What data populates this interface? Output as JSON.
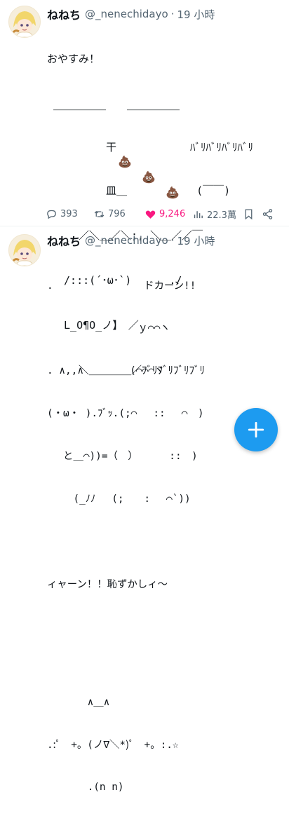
{
  "tweets": [
    {
      "display_name": "ねねち",
      "handle": "@_nenechidayo",
      "separator": "·",
      "time": "19 小時",
      "lines": [
        "おやすみ！",
        " ＿＿＿＿＿　　＿＿＿＿＿",
        "　　　　　 干　　　　　　　ﾊﾞﾘﾊﾞﾘﾊﾞﾘﾊﾞﾘ",
        "　　　　　 皿＿　　　　　　 (￣￣)",
        "　　　／＼＿／＼;, ＼＿／／￣",
        "　 /:::(´･ω･`)　　　 ./",
        "　 L_O¶O_ノ】　／",
        "　　　＼＿＿＿＿／ﾌﾞﾘﾌﾞﾘﾌﾞﾘﾌﾞﾘ"
      ],
      "poo_emoji": "💩",
      "stats": {
        "replies": "393",
        "retweets": "796",
        "likes": "9,246",
        "views": "22.3萬"
      },
      "colors": {
        "like": "#f91880",
        "meta": "#536471"
      }
    },
    {
      "display_name": "ねねち",
      "handle": "@_nenechidayo",
      "separator": "·",
      "time": "19 小時",
      "lines": [
        ".　　　　　　　　　ドカーン!!",
        "　　　　　　　　　ｙ⌒⌒ヽ",
        ". ∧,,∧　　　　 (⌒⌒⌒ヾ",
        "(・ω・ ).ﾌﾞｯ.(;⌒　 ::　 ⌒　)",
        "　 と＿⌒))=（　）　　　 ::　)",
        "　　 (_ﾉﾉ　 (;　　:　 ⌒`))",
        "",
        "ィャーン！！恥ずかしィ～",
        "",
        "",
        "　　　　∧＿∧",
        ".:ﾟ　+。(ノ∇＼*)ﾟ　+。:.☆",
        "　　　　.(n n)"
      ]
    }
  ],
  "fab": {
    "icon": "plus-icon",
    "color": "#1d9bf0"
  }
}
